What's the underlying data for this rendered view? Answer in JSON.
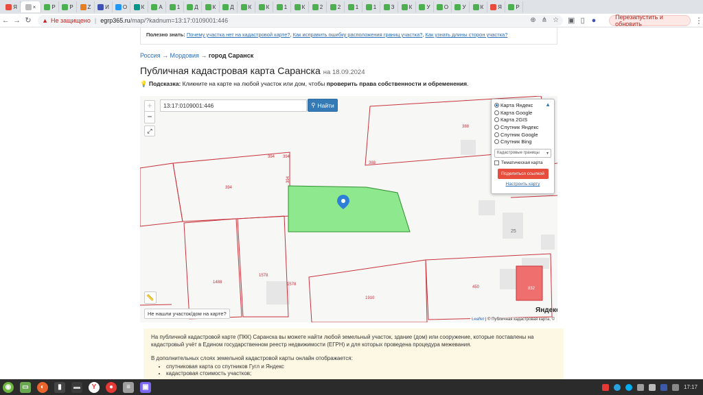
{
  "browser": {
    "tabs": [
      {
        "label": "Я",
        "color": "#e74c3c"
      },
      {
        "label": "×",
        "color": "#ffffff",
        "active": true
      },
      {
        "label": "Р",
        "color": "#4caf50"
      },
      {
        "label": "Р",
        "color": "#4caf50"
      },
      {
        "label": "Z",
        "color": "#e67e22"
      },
      {
        "label": "И",
        "color": "#3f51b5"
      },
      {
        "label": "О",
        "color": "#2196f3"
      },
      {
        "label": "К",
        "color": "#009688"
      },
      {
        "label": "А",
        "color": "#4caf50"
      },
      {
        "label": "1",
        "color": "#4caf50"
      },
      {
        "label": "Д",
        "color": "#4caf50"
      },
      {
        "label": "К",
        "color": "#4caf50"
      },
      {
        "label": "Д",
        "color": "#4caf50"
      },
      {
        "label": "К",
        "color": "#4caf50"
      },
      {
        "label": "К",
        "color": "#4caf50"
      },
      {
        "label": "1",
        "color": "#4caf50"
      },
      {
        "label": "К",
        "color": "#4caf50"
      },
      {
        "label": "2",
        "color": "#4caf50"
      },
      {
        "label": "2",
        "color": "#4caf50"
      },
      {
        "label": "1",
        "color": "#4caf50"
      },
      {
        "label": "1",
        "color": "#4caf50"
      },
      {
        "label": "З",
        "color": "#4caf50"
      },
      {
        "label": "К",
        "color": "#4caf50"
      },
      {
        "label": "У",
        "color": "#4caf50"
      },
      {
        "label": "О",
        "color": "#4caf50"
      },
      {
        "label": "У",
        "color": "#4caf50"
      },
      {
        "label": "К",
        "color": "#4caf50"
      },
      {
        "label": "Я",
        "color": "#e74c3c"
      },
      {
        "label": "Р",
        "color": "#4caf50"
      }
    ],
    "security_label": "Не защищено",
    "url_host": "egrp365.ru",
    "url_path": "/map/?kadnum=13:17:0109001:446",
    "restart_label": "Перезапустить и обновить"
  },
  "info": {
    "lead": "Полезно знать:",
    "link1": "Почему участка нет на кадастровой карте?",
    "link2": "Как исправить ошибку расположения границ участка?",
    "link3": "Как узнать длины сторон участка?"
  },
  "breadcrumb": {
    "item1": "Россия",
    "item2": "Мордовия",
    "current": "город Саранск",
    "arrow": "→"
  },
  "page": {
    "title": "Публичная кадастровая карта Саранска",
    "date": "на 18.09.2024",
    "hint_label": "Подсказка:",
    "hint_text": "Кликните на карте на любой участок или дом, чтобы",
    "hint_bold": "проверить права собственности и обременения",
    "hint_end": "."
  },
  "map": {
    "search_value": "13:17:0109001:446",
    "search_button": "Найти",
    "zoom_in": "+",
    "zoom_out": "−",
    "layers": [
      "Карта Яндекс",
      "Карта Google",
      "Карта 2GIS",
      "Спутник Яндекс",
      "Спутник Google",
      "Спутник Bing"
    ],
    "selected_layer": "Карта Яндекс",
    "cadastral_select": "Кадастровые границы",
    "thematic_label": "Тематическая карта",
    "share_button": "Поделиться ссылкой",
    "setup_link": "Настроить карту",
    "not_found_button": "Не нашли участок/дом на карте?",
    "yandex_logo": "Яндекс",
    "attribution_leaflet": "Leaflet",
    "attribution_rest": "| © Публичная кадастровая карта, ©",
    "parcel_labels": [
      "394",
      "394",
      "394",
      "394",
      "388",
      "388",
      "25",
      "1488",
      "1578",
      "1578",
      "1910",
      "450",
      "832"
    ],
    "parcel_fill": "#8ee88e",
    "boundary_color": "#c8323c"
  },
  "description": {
    "p1": "На публичной кадастровой карте (ПКК) Саранска вы можете найти любой земельный участок, здание (дом) или сооружение, которые поставлены на кадастровый учёт в Едином государственном реестр недвижимости (ЕГРН) и для которых проведена процедура межевания.",
    "p2": "В дополнительных слоях земельной кадастровой карты онлайн отображается:",
    "items": [
      "спутниковая карта со спутников Гугл и Яндекс",
      "кадастровая стоимость участков;"
    ]
  },
  "taskbar": {
    "time": "17:17"
  }
}
